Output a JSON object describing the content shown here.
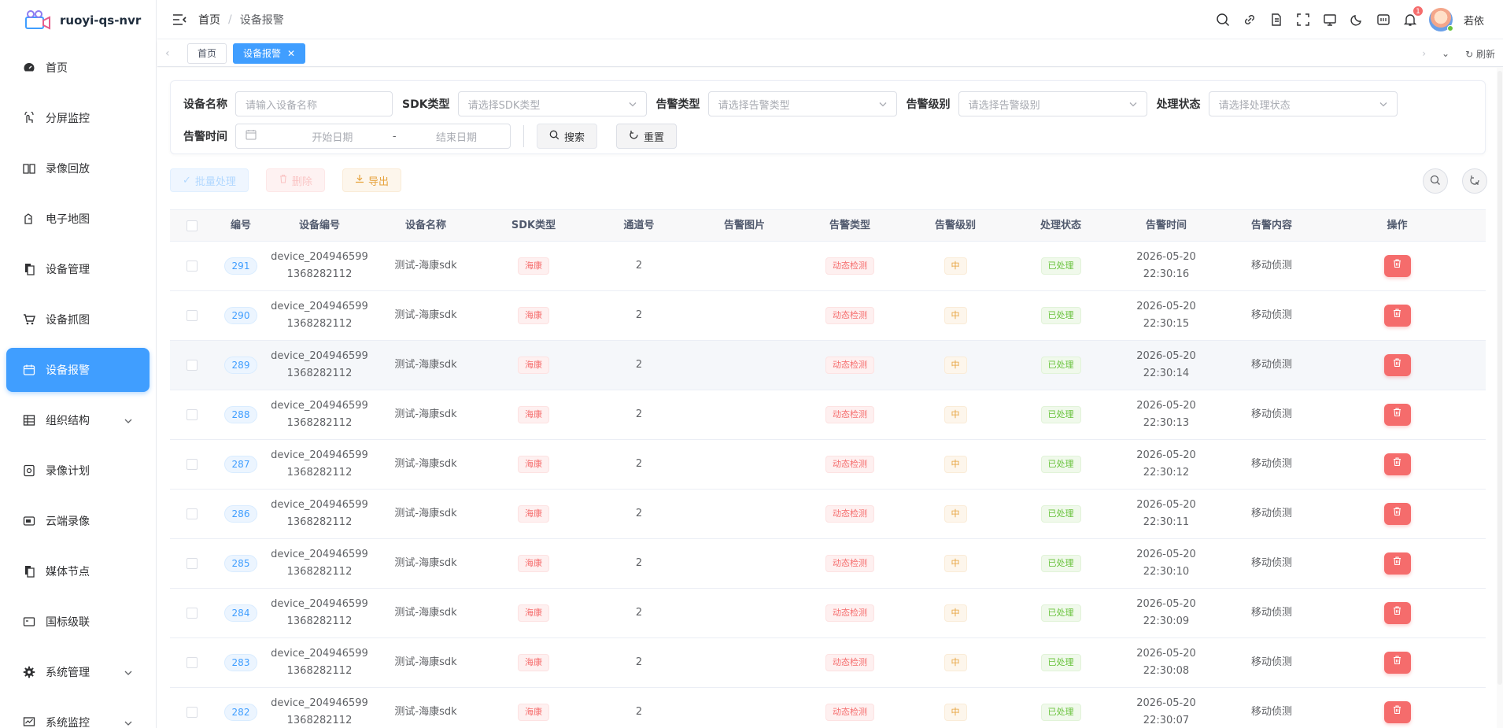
{
  "app": {
    "name": "ruoyi-qs-nvr"
  },
  "sidebar": {
    "items": [
      {
        "label": "首页",
        "icon": "dashboard-icon",
        "active": false,
        "expandable": false
      },
      {
        "label": "分屏监控",
        "icon": "monitor-hand-icon",
        "active": false,
        "expandable": false
      },
      {
        "label": "录像回放",
        "icon": "book-icon",
        "active": false,
        "expandable": false
      },
      {
        "label": "电子地图",
        "icon": "map-pin-icon",
        "active": false,
        "expandable": false
      },
      {
        "label": "设备管理",
        "icon": "device-docs-icon",
        "active": false,
        "expandable": false
      },
      {
        "label": "设备抓图",
        "icon": "cart-icon",
        "active": false,
        "expandable": false
      },
      {
        "label": "设备报警",
        "icon": "calendar-alarm-icon",
        "active": true,
        "expandable": false
      },
      {
        "label": "组织结构",
        "icon": "grid-table-icon",
        "active": false,
        "expandable": true
      },
      {
        "label": "录像计划",
        "icon": "plan-icon",
        "active": false,
        "expandable": false
      },
      {
        "label": "云端录像",
        "icon": "cloud-video-icon",
        "active": false,
        "expandable": false
      },
      {
        "label": "媒体节点",
        "icon": "media-node-icon",
        "active": false,
        "expandable": false
      },
      {
        "label": "国标级联",
        "icon": "cascade-icon",
        "active": false,
        "expandable": false
      },
      {
        "label": "系统管理",
        "icon": "gear-icon",
        "active": false,
        "expandable": true
      },
      {
        "label": "系统监控",
        "icon": "chart-monitor-icon",
        "active": false,
        "expandable": true
      }
    ]
  },
  "header": {
    "breadcrumb": [
      "首页",
      "设备报警"
    ],
    "notification_count": "1",
    "user_name": "若依"
  },
  "tags": {
    "items": [
      {
        "label": "首页",
        "active": false
      },
      {
        "label": "设备报警",
        "active": true
      }
    ],
    "refresh_label": "刷新"
  },
  "filters": {
    "device_name": {
      "label": "设备名称",
      "placeholder": "请输入设备名称"
    },
    "sdk_type": {
      "label": "SDK类型",
      "placeholder": "请选择SDK类型"
    },
    "alarm_type": {
      "label": "告警类型",
      "placeholder": "请选择告警类型"
    },
    "alarm_level": {
      "label": "告警级别",
      "placeholder": "请选择告警级别"
    },
    "status": {
      "label": "处理状态",
      "placeholder": "请选择处理状态"
    },
    "alarm_time": {
      "label": "告警时间",
      "start_placeholder": "开始日期",
      "separator": "-",
      "end_placeholder": "结束日期"
    },
    "search_label": "搜索",
    "reset_label": "重置"
  },
  "toolbar": {
    "batch_label": "批量处理",
    "delete_label": "删除",
    "export_label": "导出"
  },
  "table": {
    "columns": [
      "编号",
      "设备编号",
      "设备名称",
      "SDK类型",
      "通道号",
      "告警图片",
      "告警类型",
      "告警级别",
      "处理状态",
      "告警时间",
      "告警内容",
      "操作"
    ],
    "rows": [
      {
        "id": "291",
        "device_no_1": "device_204946599",
        "device_no_2": "1368282112",
        "device_name": "测试-海康sdk",
        "sdk": "海康",
        "channel": "2",
        "alarm_type": "动态检测",
        "level": "中",
        "status": "已处理",
        "date": "2026-05-20",
        "time": "22:30:16",
        "content": "移动侦测"
      },
      {
        "id": "290",
        "device_no_1": "device_204946599",
        "device_no_2": "1368282112",
        "device_name": "测试-海康sdk",
        "sdk": "海康",
        "channel": "2",
        "alarm_type": "动态检测",
        "level": "中",
        "status": "已处理",
        "date": "2026-05-20",
        "time": "22:30:15",
        "content": "移动侦测"
      },
      {
        "id": "289",
        "device_no_1": "device_204946599",
        "device_no_2": "1368282112",
        "device_name": "测试-海康sdk",
        "sdk": "海康",
        "channel": "2",
        "alarm_type": "动态检测",
        "level": "中",
        "status": "已处理",
        "date": "2026-05-20",
        "time": "22:30:14",
        "content": "移动侦测"
      },
      {
        "id": "288",
        "device_no_1": "device_204946599",
        "device_no_2": "1368282112",
        "device_name": "测试-海康sdk",
        "sdk": "海康",
        "channel": "2",
        "alarm_type": "动态检测",
        "level": "中",
        "status": "已处理",
        "date": "2026-05-20",
        "time": "22:30:13",
        "content": "移动侦测"
      },
      {
        "id": "287",
        "device_no_1": "device_204946599",
        "device_no_2": "1368282112",
        "device_name": "测试-海康sdk",
        "sdk": "海康",
        "channel": "2",
        "alarm_type": "动态检测",
        "level": "中",
        "status": "已处理",
        "date": "2026-05-20",
        "time": "22:30:12",
        "content": "移动侦测"
      },
      {
        "id": "286",
        "device_no_1": "device_204946599",
        "device_no_2": "1368282112",
        "device_name": "测试-海康sdk",
        "sdk": "海康",
        "channel": "2",
        "alarm_type": "动态检测",
        "level": "中",
        "status": "已处理",
        "date": "2026-05-20",
        "time": "22:30:11",
        "content": "移动侦测"
      },
      {
        "id": "285",
        "device_no_1": "device_204946599",
        "device_no_2": "1368282112",
        "device_name": "测试-海康sdk",
        "sdk": "海康",
        "channel": "2",
        "alarm_type": "动态检测",
        "level": "中",
        "status": "已处理",
        "date": "2026-05-20",
        "time": "22:30:10",
        "content": "移动侦测"
      },
      {
        "id": "284",
        "device_no_1": "device_204946599",
        "device_no_2": "1368282112",
        "device_name": "测试-海康sdk",
        "sdk": "海康",
        "channel": "2",
        "alarm_type": "动态检测",
        "level": "中",
        "status": "已处理",
        "date": "2026-05-20",
        "time": "22:30:09",
        "content": "移动侦测"
      },
      {
        "id": "283",
        "device_no_1": "device_204946599",
        "device_no_2": "1368282112",
        "device_name": "测试-海康sdk",
        "sdk": "海康",
        "channel": "2",
        "alarm_type": "动态检测",
        "level": "中",
        "status": "已处理",
        "date": "2026-05-20",
        "time": "22:30:08",
        "content": "移动侦测"
      },
      {
        "id": "282",
        "device_no_1": "device_204946599",
        "device_no_2": "1368282112",
        "device_name": "测试-海康sdk",
        "sdk": "海康",
        "channel": "2",
        "alarm_type": "动态检测",
        "level": "中",
        "status": "已处理",
        "date": "2026-05-20",
        "time": "22:30:07",
        "content": "移动侦测"
      }
    ],
    "highlighted_row": "289"
  },
  "colors": {
    "primary": "#409eff",
    "danger": "#f56c6c",
    "warning": "#e6a23c",
    "success": "#67c23a"
  }
}
